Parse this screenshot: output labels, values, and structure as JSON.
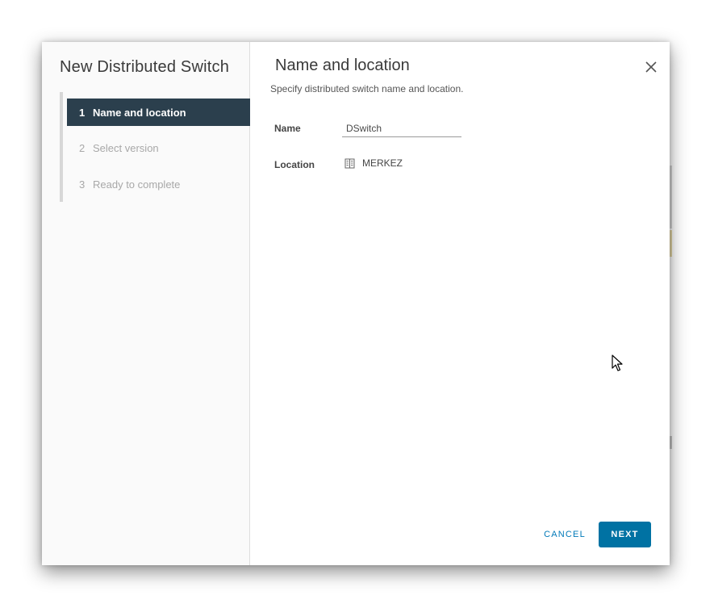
{
  "wizard": {
    "title": "New Distributed Switch",
    "steps": [
      {
        "num": "1",
        "label": "Name and location",
        "active": true
      },
      {
        "num": "2",
        "label": "Select version",
        "active": false
      },
      {
        "num": "3",
        "label": "Ready to complete",
        "active": false
      }
    ]
  },
  "page": {
    "title": "Name and location",
    "subtitle": "Specify distributed switch name and location."
  },
  "form": {
    "name_label": "Name",
    "name_value": "DSwitch",
    "location_label": "Location",
    "location_value": "MERKEZ",
    "location_icon": "datacenter-icon"
  },
  "footer": {
    "cancel_label": "CANCEL",
    "next_label": "NEXT"
  },
  "colors": {
    "active_step_bg": "#2b3f4d",
    "primary": "#0072a3",
    "link": "#0079b8"
  }
}
